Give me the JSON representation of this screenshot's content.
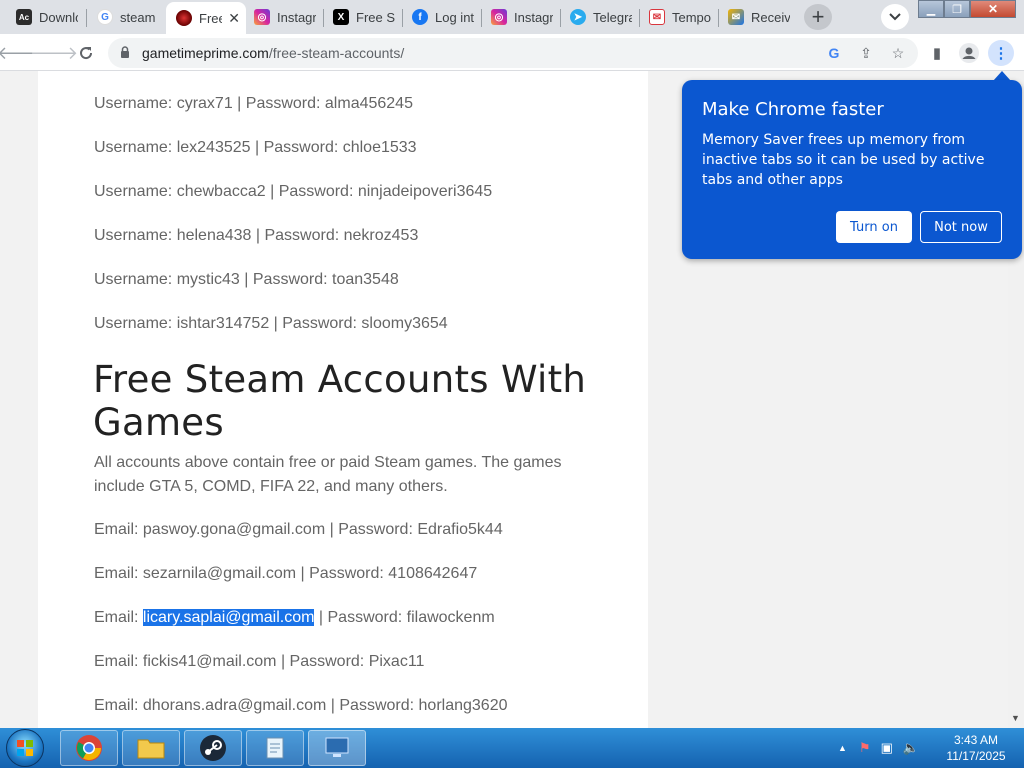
{
  "browser": {
    "tabs": [
      {
        "label": "Downlo",
        "icon": "acrobat-icon"
      },
      {
        "label": "steam a",
        "icon": "google-icon"
      },
      {
        "label": "Free",
        "icon": "site-icon",
        "active": true
      },
      {
        "label": "Instagr",
        "icon": "instagram-icon"
      },
      {
        "label": "Free St",
        "icon": "x-icon"
      },
      {
        "label": "Log int",
        "icon": "facebook-icon"
      },
      {
        "label": "Instagr",
        "icon": "instagram-icon"
      },
      {
        "label": "Telegra",
        "icon": "telegram-icon"
      },
      {
        "label": "Tempo",
        "icon": "tempmail-icon"
      },
      {
        "label": "Receive",
        "icon": "receive-sms-icon"
      }
    ],
    "url": {
      "host": "gametimeprime.com",
      "path": "/free-steam-accounts/"
    }
  },
  "page": {
    "accounts": [
      "Username: cyrax71 | Password: alma456245",
      "Username: lex243525 | Password: chloe1533",
      "Username: chewbacca2 | Password: ninjadeipoveri3645",
      "Username: helena438 | Password: nekroz453",
      "Username: mystic43 | Password: toan3548",
      "Username: ishtar314752 | Password: sloomy3654"
    ],
    "heading": "Free Steam Accounts With Games",
    "paragraph": "All accounts above contain free or paid Steam games. The games include GTA 5, COMD, FIFA 22, and many others.",
    "emails": [
      "Email: paswoy.gona@gmail.com | Password: Edrafio5k44",
      "Email: sezarnila@gmail.com | Password: 4108642647"
    ],
    "selected_email": {
      "prefix": "Email: ",
      "selected": "licary.saplai@gmail.com",
      "suffix": " | Password: filawockenm"
    },
    "emails_after": [
      "Email: fickis41@mail.com | Password: Pixac11",
      "Email: dhorans.adra@gmail.com | Password: horlang3620"
    ]
  },
  "popup": {
    "title": "Make Chrome faster",
    "body": "Memory Saver frees up memory from inactive tabs so it can be used by active tabs and other apps",
    "turn_on": "Turn on",
    "not_now": "Not now"
  },
  "taskbar": {
    "time": "3:43 AM",
    "date": "11/17/2025"
  }
}
